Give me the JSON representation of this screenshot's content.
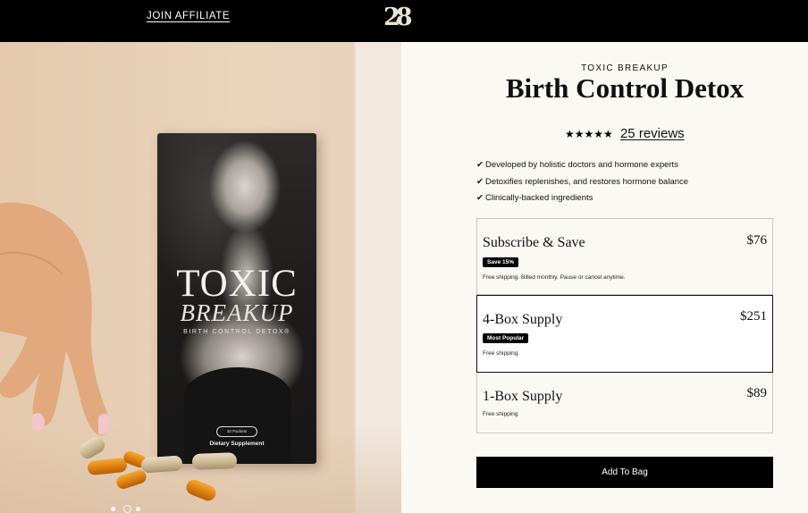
{
  "header": {
    "affiliate_label": "JOIN AFFILIATE",
    "logo_text": "28"
  },
  "gallery": {
    "box_title_line1": "TOXIC",
    "box_title_line2": "BREAKUP",
    "box_subtitle": "BIRTH CONTROL DETOX®",
    "box_pill": "30 Packets",
    "box_footer": "Dietary Supplement",
    "slide_count": 3,
    "active_slide": 2
  },
  "product": {
    "brand": "TOXIC BREAKUP",
    "title": "Birth Control Detox",
    "stars": "★★★★★",
    "reviews_label": "25 reviews",
    "bullets": [
      "Developed by holistic doctors and hormone experts",
      "Detoxifies replenishes, and restores hormone balance",
      "Clinically-backed ingredients"
    ],
    "check_glyph": "✔"
  },
  "options": [
    {
      "name": "Subscribe & Save",
      "price": "$76",
      "badge": "Save 15%",
      "note": "Free shipping. Billed monthly. Pause or cancel anytime."
    },
    {
      "name": "4-Box Supply",
      "price": "$251",
      "badge": "Most Popular",
      "note": "Free shipping.",
      "selected": true
    },
    {
      "name": "1-Box Supply",
      "price": "$89",
      "note": "Free shipping"
    }
  ],
  "cta": {
    "label": "Add To Bag"
  }
}
